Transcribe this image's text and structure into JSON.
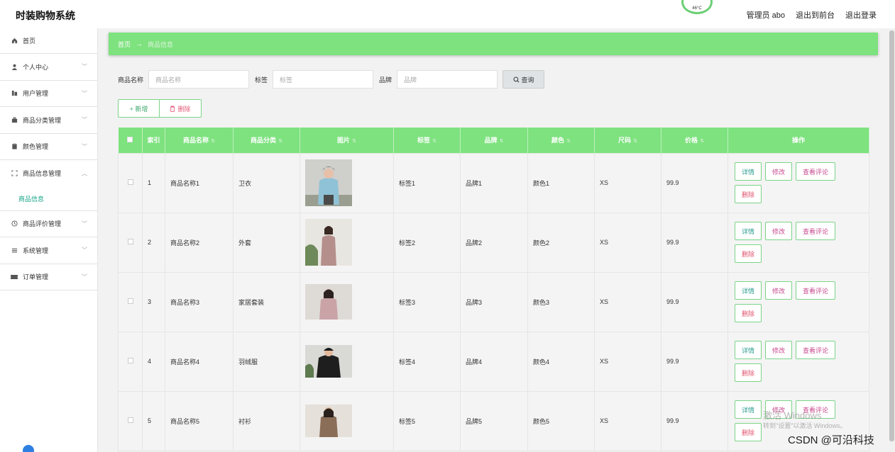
{
  "app": {
    "title": "时装购物系统"
  },
  "header": {
    "admin": "管理员 abo",
    "to_frontend": "退出到前台",
    "logout": "退出登录",
    "gauge_text": "46°C"
  },
  "sidebar": {
    "items": [
      {
        "label": "首页",
        "icon": "home-icon"
      },
      {
        "label": "个人中心",
        "icon": "user-icon"
      },
      {
        "label": "用户管理",
        "icon": "building-icon"
      },
      {
        "label": "商品分类管理",
        "icon": "briefcase-icon"
      },
      {
        "label": "颜色管理",
        "icon": "clipboard-icon"
      },
      {
        "label": "商品信息管理",
        "icon": "frame-icon"
      },
      {
        "label": "商品评价管理",
        "icon": "clock-icon"
      },
      {
        "label": "系统管理",
        "icon": "list-icon"
      },
      {
        "label": "订单管理",
        "icon": "ticket-icon"
      }
    ],
    "sub_active": "商品信息"
  },
  "breadcrumb": {
    "home": "首页",
    "arrow": "→",
    "current": "商品信息"
  },
  "search": {
    "name_label": "商品名称",
    "name_placeholder": "商品名称",
    "tag_label": "标签",
    "tag_placeholder": "标签",
    "brand_label": "品牌",
    "brand_placeholder": "品牌",
    "query_label": "查询"
  },
  "actions": {
    "add": "+ 新增",
    "delete": "删除"
  },
  "table": {
    "headers": [
      "索引",
      "商品名称",
      "商品分类",
      "图片",
      "标签",
      "品牌",
      "颜色",
      "尺码",
      "价格",
      "操作"
    ],
    "rows": [
      {
        "index": "1",
        "name": "商品名称1",
        "category": "卫衣",
        "tag": "标签1",
        "brand": "品牌1",
        "color": "颜色1",
        "size": "XS",
        "price": "99.9"
      },
      {
        "index": "2",
        "name": "商品名称2",
        "category": "外套",
        "tag": "标签2",
        "brand": "品牌2",
        "color": "颜色2",
        "size": "XS",
        "price": "99.9"
      },
      {
        "index": "3",
        "name": "商品名称3",
        "category": "家居套装",
        "tag": "标签3",
        "brand": "品牌3",
        "color": "颜色3",
        "size": "XS",
        "price": "99.9"
      },
      {
        "index": "4",
        "name": "商品名称4",
        "category": "羽绒服",
        "tag": "标签4",
        "brand": "品牌4",
        "color": "颜色4",
        "size": "XS",
        "price": "99.9"
      },
      {
        "index": "5",
        "name": "商品名称5",
        "category": "衬衫",
        "tag": "标签5",
        "brand": "品牌5",
        "color": "颜色5",
        "size": "XS",
        "price": "99.9"
      }
    ],
    "ops": {
      "detail": "详情",
      "edit": "修改",
      "review": "查看评论",
      "remove": "删除"
    }
  },
  "overlay": {
    "win1": "激活 Windows",
    "win2": "转到\"设置\"以激活 Windows。",
    "csdn": "CSDN @可沿科技"
  },
  "colors": {
    "accent": "#7ee27f",
    "link": "#17a589"
  }
}
